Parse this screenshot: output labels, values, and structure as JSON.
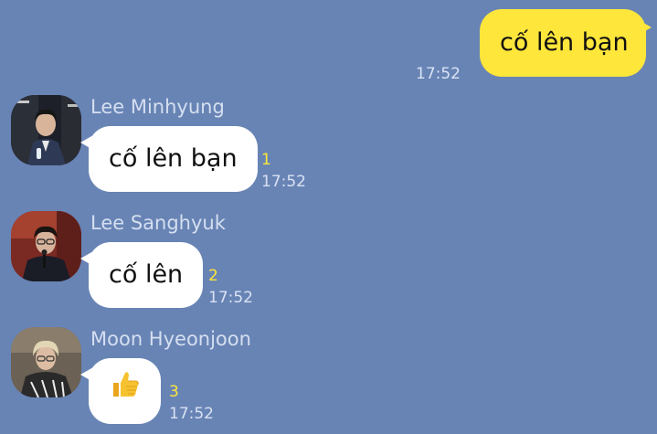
{
  "outgoing": {
    "text": "cố lên bạn",
    "time": "17:52"
  },
  "messages": [
    {
      "sender": "Lee Minhyung",
      "text": "cố lên bạn",
      "unread": "1",
      "time": "17:52",
      "avatar": "avatar-lee-minhyung"
    },
    {
      "sender": "Lee Sanghyuk",
      "text": "cố lên",
      "unread": "2",
      "time": "17:52",
      "avatar": "avatar-lee-sanghyuk"
    },
    {
      "sender": "Moon Hyeonjoon",
      "text": "👍",
      "unread": "3",
      "time": "17:52",
      "avatar": "avatar-moon-hyeonjoon"
    }
  ],
  "colors": {
    "background": "#6884b5",
    "my_bubble": "#fee63b",
    "their_bubble": "#ffffff",
    "unread": "#fee63b"
  }
}
